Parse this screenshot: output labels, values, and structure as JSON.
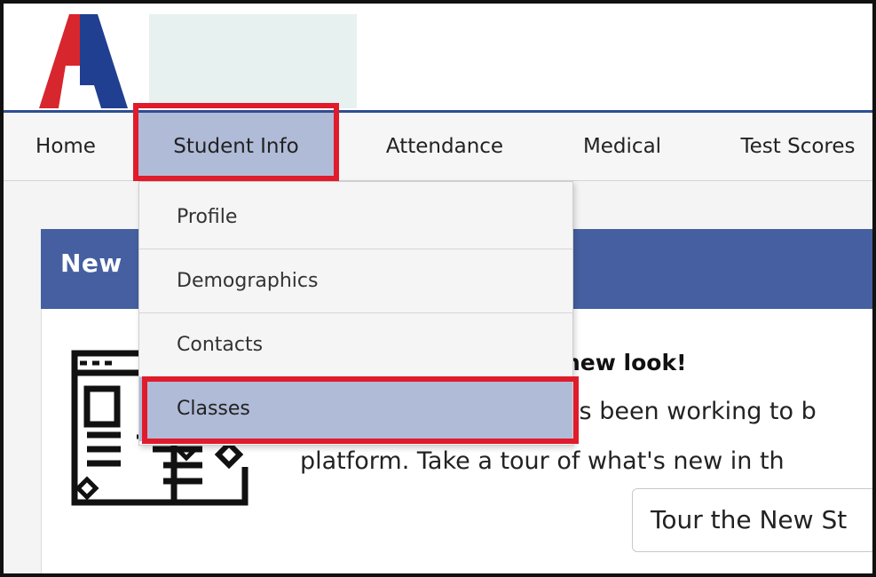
{
  "nav": {
    "items": [
      {
        "label": "Home"
      },
      {
        "label": "Student Info"
      },
      {
        "label": "Attendance"
      },
      {
        "label": "Medical"
      },
      {
        "label": "Test Scores"
      }
    ]
  },
  "dropdown": {
    "items": [
      {
        "label": "Profile"
      },
      {
        "label": "Demographics"
      },
      {
        "label": "Contacts"
      },
      {
        "label": "Classes"
      }
    ]
  },
  "panel": {
    "title": "New",
    "headline": "new look!",
    "line1": "as been working to b",
    "line2": "platform. Take a tour of what's new in th",
    "tour_button": "Tour the New St"
  },
  "colors": {
    "accent": "#455fa0",
    "nav_active": "#b0bbd8",
    "highlight": "#e01b2b",
    "logo_red": "#d8262e",
    "logo_blue": "#213f91"
  }
}
